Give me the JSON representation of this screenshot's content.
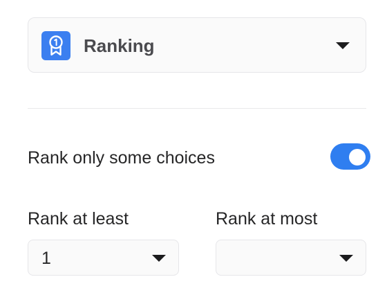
{
  "question_type": {
    "icon": "ribbon-medal-icon",
    "icon_color": "#3b7ff0",
    "label": "Ranking"
  },
  "rank_only_some": {
    "label": "Rank only some choices",
    "enabled": true,
    "toggle_color": "#2f7ef0"
  },
  "rank_at_least": {
    "label": "Rank at least",
    "value": "1"
  },
  "rank_at_most": {
    "label": "Rank at most",
    "value": ""
  }
}
